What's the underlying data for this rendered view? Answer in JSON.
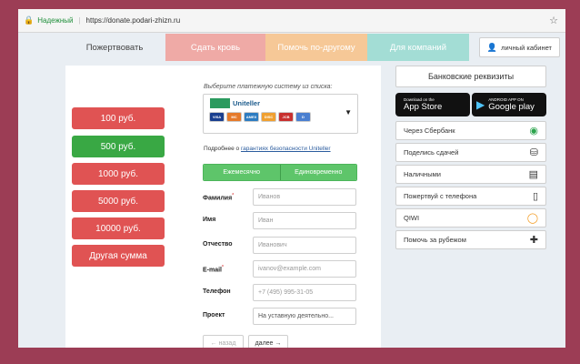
{
  "browser": {
    "secure_label": "Надежный",
    "url": "https://donate.podari-zhizn.ru"
  },
  "nav": {
    "tabs": [
      "Пожертвовать",
      "Сдать кровь",
      "Помочь по-другому",
      "Для компаний"
    ],
    "cabinet": "личный кабинет"
  },
  "amounts": {
    "items": [
      "100 руб.",
      "500 руб.",
      "1000 руб.",
      "5000 руб.",
      "10000 руб.",
      "Другая сумма"
    ],
    "selected": "500 руб."
  },
  "payment": {
    "choose_label": "Выберите платежную систему из списка:",
    "selected_system": "Uniteller",
    "cards": [
      "VISA",
      "MC",
      "AMEX",
      "DISC",
      "JCB",
      "D"
    ],
    "guarantee_prefix": "Подробнее о",
    "guarantee_link": "гарантиях безопасности Uniteller"
  },
  "frequency": {
    "monthly": "Ежемесячно",
    "once": "Единовременно"
  },
  "form": {
    "lastname_label": "Фамилия",
    "lastname_placeholder": "Иванов",
    "name_label": "Имя",
    "name_placeholder": "Иван",
    "patronymic_label": "Отчество",
    "patronymic_placeholder": "Иванович",
    "email_label": "E-mail",
    "email_placeholder": "ivanov@example.com",
    "phone_label": "Телефон",
    "phone_placeholder": "+7 (495) 995-31-05",
    "project_label": "Проект",
    "project_value": "На уставную деятельно...",
    "required_mark": "*"
  },
  "buttons": {
    "back": "← назад",
    "next": "далее →"
  },
  "sidebar": {
    "bank_details": "Банковские реквизиты",
    "appstore_small": "Download on the",
    "appstore_big": "App Store",
    "googleplay_small": "ANDROID APP ON",
    "googleplay_big": "Google play",
    "methods": [
      "Через Сбербанк",
      "Поделись сдачей",
      "Наличными",
      "Пожертвуй с телефона",
      "QIWI",
      "Помочь за рубежом"
    ]
  },
  "colors": {
    "background": "#9c3d55",
    "amount_button": "#e05353",
    "amount_selected": "#39a844",
    "tab_blood": "#efaaa6",
    "tab_other": "#f6c897",
    "tab_companies": "#a3ddd5"
  },
  "icons": {
    "sberbank": "sberbank-icon",
    "coins": "coins-icon",
    "cash": "cash-icon",
    "phone": "mobile-phone-icon",
    "qiwi": "qiwi-icon",
    "abroad": "uk-flag-icon"
  }
}
